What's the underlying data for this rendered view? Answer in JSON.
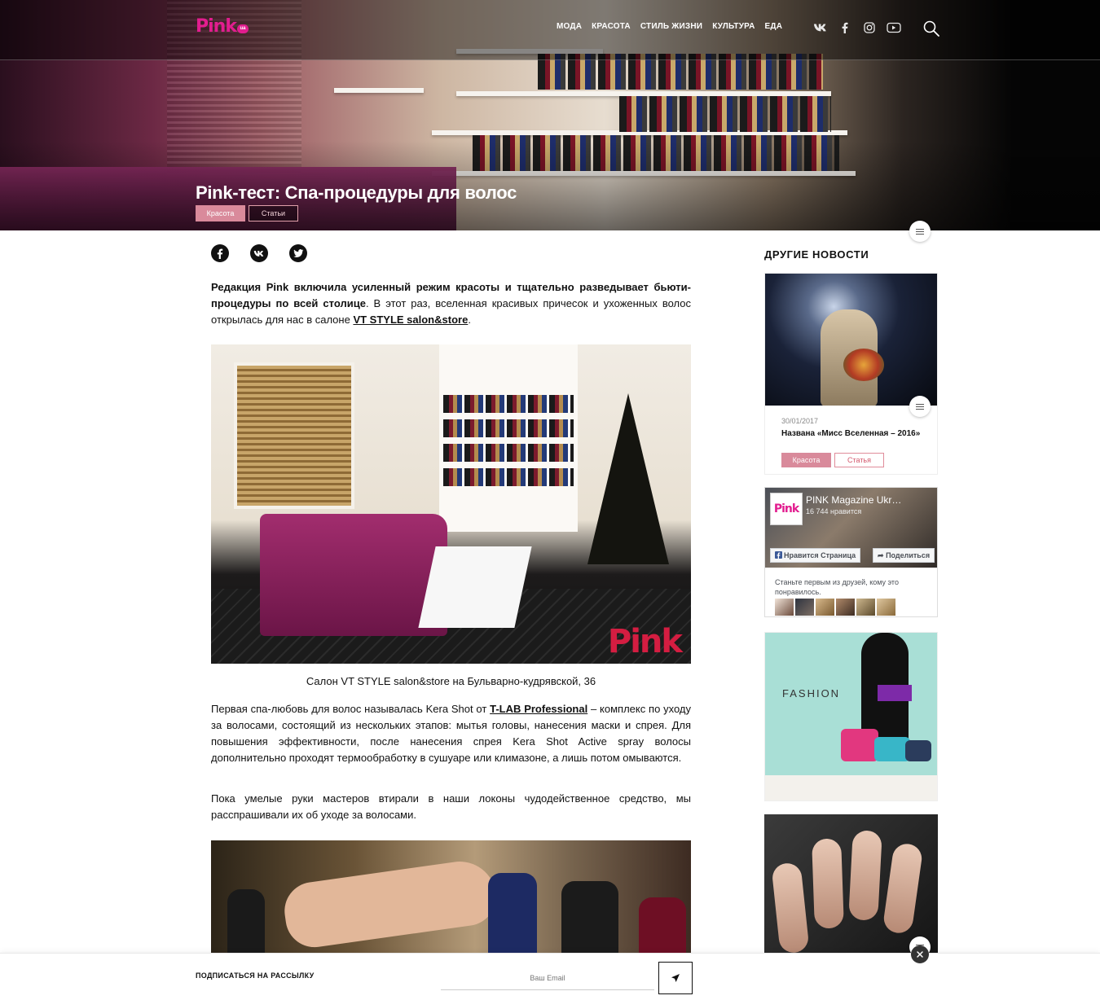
{
  "header": {
    "logo_text": "Pink",
    "logo_badge": "ua",
    "nav": [
      "Мода",
      "Красота",
      "Стиль жизни",
      "Культура",
      "Еда"
    ]
  },
  "hero": {
    "title": "Pink-тест: Спа-процедуры для волос",
    "tag_primary": "Красота",
    "tag_secondary": "Статьи"
  },
  "article": {
    "intro_bold": "Редакция Pink включила усиленный режим красоты и тщательно разведывает бьюти-процедуры по всей столице",
    "intro_rest": ". В этот раз, вселенная красивых причесок и ухоженных волос открылась для нас в салоне ",
    "intro_link": "VT STYLE salon&store",
    "intro_end": ".",
    "photo_watermark": "Pink",
    "caption": "Салон VT STYLE salon&store на Бульварно-кудрявской, 36",
    "p2_start": "Первая спа-любовь для волос называлась Kera Shot от ",
    "p2_link": "T-LAB Professional",
    "p2_rest": " – комплекс по уходу за волосами, состоящий из нескольких этапов: мытья головы, нанесения маски и спрея. Для повышения эффективности, после нанесения спрея Kera Shot Active spray волосы дополнительно проходят термообработку в сушуаре или климазоне, а лишь потом омываются.",
    "p3": "Пока умелые руки мастеров втирали в наши локоны чудодейственное средство, мы расспрашивали их об уходе за волосами."
  },
  "sidebar": {
    "title": "Другие новости",
    "card": {
      "date": "30/01/2017",
      "title": "Названа «Мисс Вселенная – 2016»",
      "tag1": "Красота",
      "tag2": "Статья"
    },
    "facebook": {
      "logo": "Pink",
      "page_name": "PINK Magazine Ukr…",
      "likes": "16 744 нравится",
      "like_button": "Нравится Страница",
      "share_button": "Поделиться",
      "prompt": "Станьте первым из друзей, кому это понравилось."
    },
    "ad_text": "FASHION"
  },
  "subscribe": {
    "label": "Подписаться на рассылку",
    "placeholder": "Ваш Email"
  }
}
